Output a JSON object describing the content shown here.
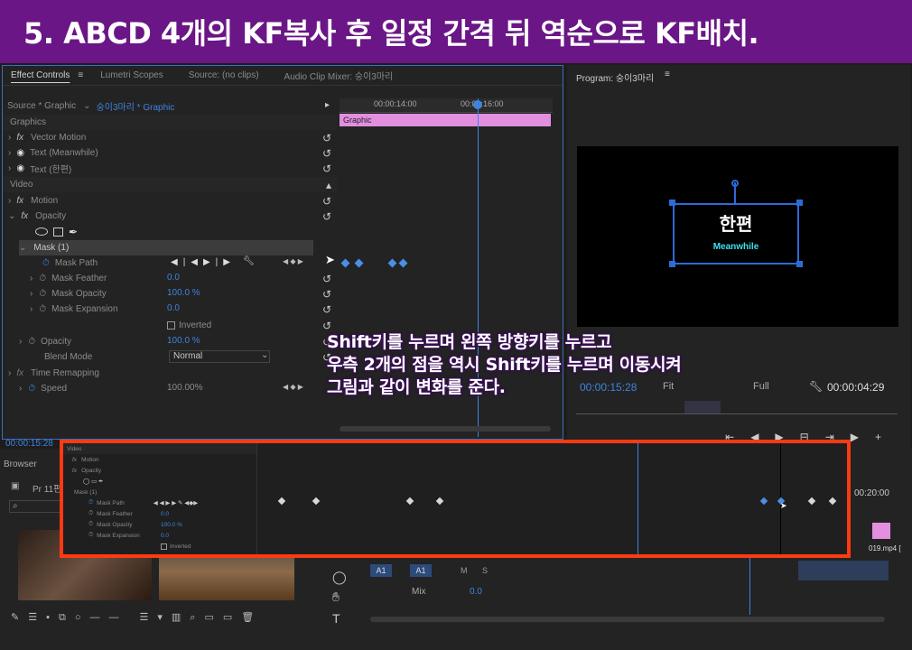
{
  "banner": {
    "title": "5. ABCD 4개의 KF복사 후 일정 간격 뒤 역순으로 KF배치."
  },
  "tabs": {
    "effect_controls": "Effect Controls",
    "lumetri": "Lumetri Scopes",
    "source": "Source: (no clips)",
    "audio_mixer": "Audio Clip Mixer: 숭이3마리"
  },
  "program": {
    "title": "Program: 숭이3마리",
    "timecode": "00:00:15:28",
    "fit": "Fit",
    "full": "Full",
    "duration": "00:00:04:29",
    "clip_title": "한편",
    "clip_sub": "Meanwhile"
  },
  "ec": {
    "source": "Source * Graphic",
    "seq": "숭이3마리 * Graphic",
    "time1": "00:00:14:00",
    "time2": "00:00:16:00",
    "clip": "Graphic",
    "graphics": "Graphics",
    "vector_motion": "Vector Motion",
    "text_meanwhile": "Text (Meanwhile)",
    "text_hanpyeon": "Text (한편)",
    "video": "Video",
    "motion": "Motion",
    "opacity": "Opacity",
    "mask": "Mask (1)",
    "mask_path": "Mask Path",
    "mask_feather": "Mask Feather",
    "mask_feather_val": "0.0",
    "mask_opacity": "Mask Opacity",
    "mask_opacity_val": "100.0 %",
    "mask_expansion": "Mask Expansion",
    "mask_expansion_val": "0.0",
    "inverted": "Inverted",
    "opacity2": "Opacity",
    "opacity2_val": "100.0 %",
    "blend": "Blend Mode",
    "blend_val": "Normal",
    "time_remap": "Time Remapping",
    "speed": "Speed",
    "speed_val": "100.00%",
    "timecode": "00:00:15:28"
  },
  "overlay": {
    "video": "Video",
    "motion": "Motion",
    "opacity": "Opacity",
    "mask": "Mask (1)",
    "mask_path": "Mask Path",
    "mask_feather": "Mask Feather",
    "mf_val": "0.0",
    "mask_opacity": "Mask Opacity",
    "mo_val": "100.0 %",
    "mask_expansion": "Mask Expansion",
    "me_val": "0.0",
    "inverted": "Inverted"
  },
  "annotation": {
    "line1": "Shift키를 누르며 왼쪽 방향키를 누르고",
    "line2": "우측 2개의 점을 역시 Shift키를 누르며 이동시켜",
    "line3": "그림과 같이  변화를 준다."
  },
  "browser": {
    "title": "Browser",
    "item": "Pr 11편"
  },
  "timeline": {
    "time": "00:20:00",
    "clip": "019.mp4 [",
    "track_a1": "A1",
    "mix": "Mix",
    "mix_val": "0.0",
    "m": "M",
    "s": "S"
  }
}
